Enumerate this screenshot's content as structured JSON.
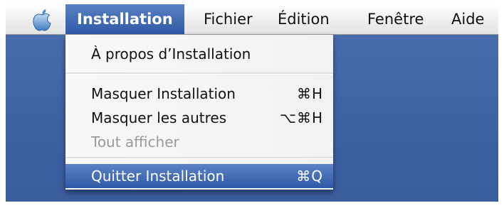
{
  "menubar": {
    "apple_icon": "apple-logo-icon",
    "items": [
      {
        "label": "Installation"
      },
      {
        "label": "Fichier"
      },
      {
        "label": "Édition"
      },
      {
        "label": "Fenêtre"
      },
      {
        "label": "Aide"
      }
    ]
  },
  "menu": {
    "items": [
      {
        "label": "À propos d’Installation",
        "shortcut": ""
      },
      {
        "label": "Masquer Installation",
        "shortcut": "⌘H"
      },
      {
        "label": "Masquer les autres",
        "shortcut": "⌥⌘H"
      },
      {
        "label": "Tout afficher",
        "shortcut": ""
      },
      {
        "label": "Quitter Installation",
        "shortcut": "⌘Q"
      }
    ]
  },
  "colors": {
    "highlight": "#3b63aa",
    "desktop": "#4368a7",
    "disabled_text": "#9a9a9a"
  }
}
